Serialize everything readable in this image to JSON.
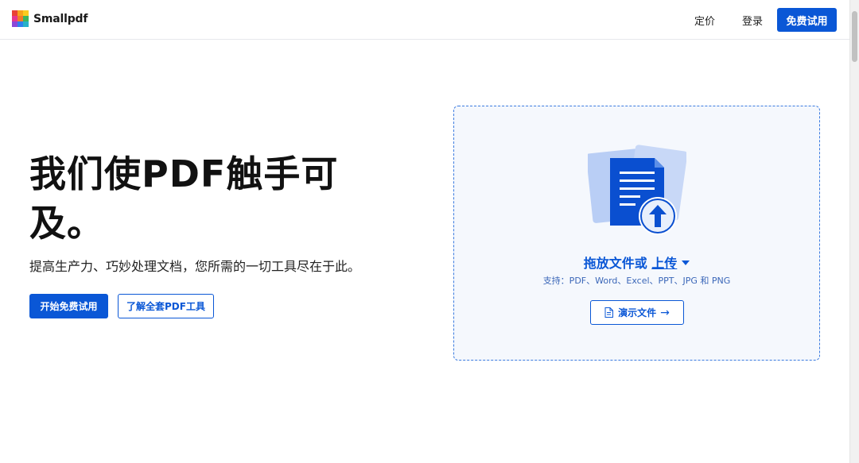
{
  "header": {
    "brand": "Smallpdf",
    "nav": {
      "pricing": "定价",
      "login": "登录",
      "free_trial": "免费试用"
    }
  },
  "hero": {
    "title": "我们使PDF触手可及。",
    "subtitle": "提高生产力、巧妙处理文档，您所需的一切工具尽在于此。",
    "primary_cta": "开始免费试用",
    "secondary_cta": "了解全套PDF工具"
  },
  "dropzone": {
    "drop_text": "拖放文件或",
    "upload_link": "上传",
    "supported": "支持：PDF、Word、Excel、PPT、JPG 和 PNG",
    "demo_button": "演示文件",
    "demo_arrow": "→"
  },
  "icons": {
    "logo": "smallpdf-logo-icon",
    "upload": "upload-document-icon",
    "caret": "caret-down-icon",
    "demo": "document-icon"
  },
  "colors": {
    "brand_blue": "#0a57d6",
    "dropzone_bg": "#f5f8fd",
    "dropzone_border": "#3b7be0"
  }
}
